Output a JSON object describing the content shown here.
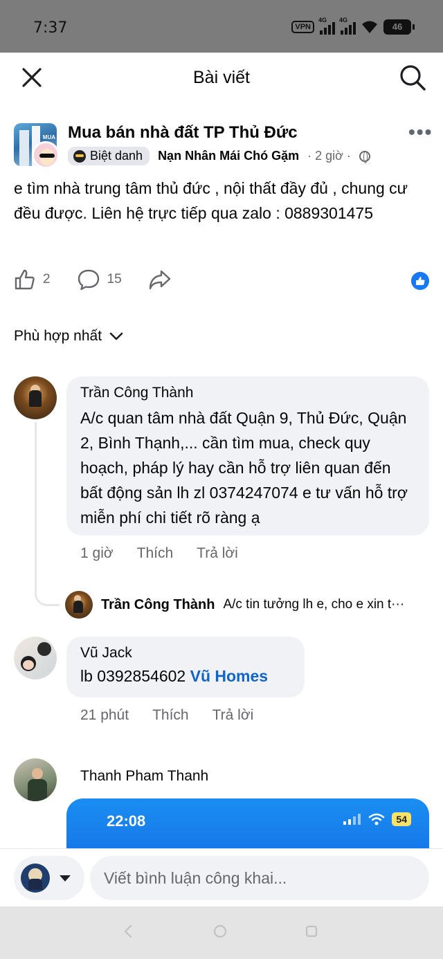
{
  "status_bar": {
    "time": "7:37",
    "vpn": "VPN",
    "network_1": "4G",
    "network_2": "4G",
    "battery": "46"
  },
  "header": {
    "title": "Bài viết",
    "close_icon": "close-icon",
    "search_icon": "search-icon"
  },
  "post": {
    "group_name": "Mua bán nhà đất TP Thủ Đức",
    "badge_label": "Biệt danh",
    "author": "Nạn Nhân Mái Chó Gặm",
    "time": "· 2 giờ ·",
    "text": "e tìm nhà trung tâm thủ đức , nội thất đầy đủ , chung cư đều được. Liên hệ trực tiếp qua zalo : 0889301475",
    "likes": "2",
    "comments": "15",
    "accent_color": "#1877f2"
  },
  "sort": {
    "label": "Phù hợp nhất"
  },
  "comments": [
    {
      "name": "Trần Công Thành",
      "text": "A/c quan tâm nhà đất Quận 9, Thủ Đức, Quận 2, Bình Thạnh,... cần tìm mua, check quy hoạch, pháp lý hay cần hỗ trợ liên quan đến bất động sản lh zl 0374247074 e tư vấn hỗ trợ miễn phí chi tiết rõ ràng ạ",
      "time": "1 giờ",
      "like": "Thích",
      "reply": "Trả lời",
      "reply_preview": {
        "name": "Trần Công Thành",
        "text": "A/c tin tưởng lh e, cho e xin t···"
      }
    },
    {
      "name": "Vũ Jack",
      "text": "lb 0392854602 ",
      "mention": "Vũ Homes",
      "time": "21 phút",
      "like": "Thích",
      "reply": "Trả lời"
    },
    {
      "name": "Thanh Pham Thanh",
      "attachment": {
        "time": "22:08",
        "battery": "54"
      }
    }
  ],
  "composer": {
    "placeholder": "Viết bình luận công khai..."
  }
}
